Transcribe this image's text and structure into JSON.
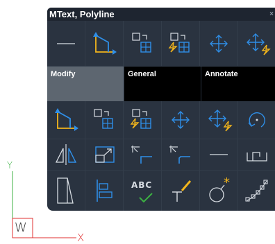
{
  "palette": {
    "title": "MText, Polyline",
    "close_glyph": "×",
    "tabs": [
      {
        "label": "Modify",
        "active": true
      },
      {
        "label": "General",
        "active": false
      },
      {
        "label": "Annotate",
        "active": false
      }
    ],
    "row1": [
      "line-icon",
      "polyline-icon",
      "copy-icon",
      "copy-move-lightning-icon",
      "move-icon",
      "move-lightning-icon"
    ],
    "row2": [
      "polyline-icon",
      "copy-icon",
      "copy-move-lightning-icon",
      "move-icon",
      "move-lightning-icon",
      "rotate-icon"
    ],
    "row3": [
      "mirror-icon",
      "scale-icon",
      "fillet-icon",
      "chamfer-icon",
      "line-icon",
      "stretch-icon"
    ],
    "row4": [
      "hatch-icon",
      "align-icon",
      "text-abc-check-icon",
      "multileader-icon",
      "explode-icon",
      "array-path-icon"
    ],
    "abc_text": "ABC"
  },
  "ucs": {
    "y_label": "Y",
    "x_label": "X",
    "w_label": "W"
  },
  "colors": {
    "accent_blue": "#2f8fe8",
    "accent_yellow": "#f2b51c",
    "ucs_green": "#3cb043",
    "ucs_red": "#e03030"
  }
}
